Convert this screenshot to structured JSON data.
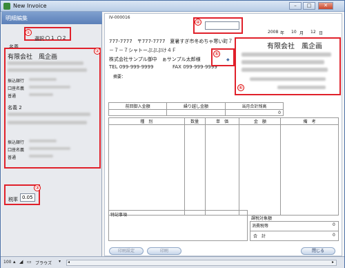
{
  "window": {
    "title": "New Invoice",
    "minimize": "–",
    "maximize": "□",
    "close": "✕"
  },
  "left": {
    "header": "明細編集",
    "select_label": "選択",
    "option1": "1",
    "option2": "2",
    "name_label": "名義",
    "company": "有限会社　風企画",
    "bank_label": "振込銀行",
    "holder_label": "口座名義",
    "ordinary_label": "普通",
    "name2_label": "名義 2",
    "bank_label2": "振込銀行",
    "holder_label2": "口座名義",
    "ordinary_label2": "普通",
    "tax_label": "税率",
    "tax_value": "0.05"
  },
  "markers": [
    "①",
    "②",
    "③",
    "④",
    "⑤",
    "⑥"
  ],
  "doc": {
    "invoice_no": "IV-000016",
    "date": {
      "year": "2008",
      "year_unit": "年",
      "month": "10",
      "month_unit": "月",
      "day": "12",
      "day_unit": "日"
    },
    "client_phone_zip": "777-7777　〒777-7777　夏暑すぎ市冬めちゃ寒い町７",
    "client_address2": "－７－７シャトーぷぷぷけ４Ｆ",
    "client_name": "株式会社サンプル御中　ぁサンプル太郎様",
    "tel": "TEL 099-999-9999",
    "fax": "FAX 099-999-9999",
    "summary_label": "摘要：",
    "issuer": "有限会社　風企画",
    "summary_headers": [
      "前回御入金額",
      "繰り越し金額",
      "当月合計残高"
    ],
    "summary_values": [
      "",
      "",
      "0"
    ],
    "item_headers": [
      "種　別",
      "数量",
      "単　価",
      "金　額",
      "備　考"
    ],
    "notes_label": "特記事項",
    "taxable_label": "課税対象額",
    "consumption_tax_label": "消費税等",
    "consumption_tax_value": "0",
    "total_label": "合　計",
    "total_value": "0"
  },
  "buttons": {
    "print_settings": "印刷設定",
    "print": "印刷",
    "close": "閉じる"
  },
  "statusbar": {
    "zoom": "100",
    "mode": "ブラウズ"
  }
}
